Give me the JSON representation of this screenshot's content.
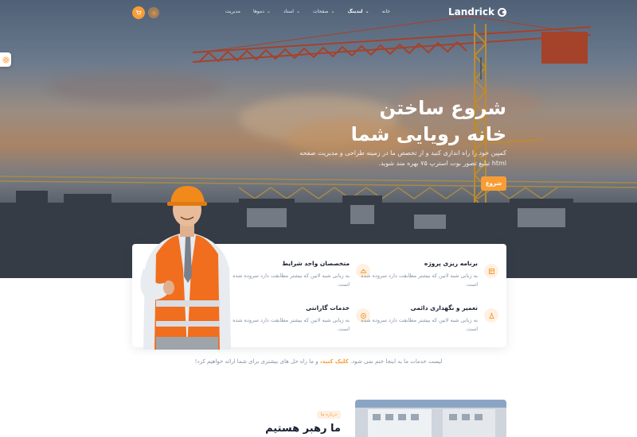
{
  "brand": {
    "name": "Landrick"
  },
  "nav": {
    "items": [
      {
        "label": "خانه",
        "dropdown": false,
        "active": false
      },
      {
        "label": "لندینگ",
        "dropdown": true,
        "active": true
      },
      {
        "label": "صفحات",
        "dropdown": true,
        "active": false
      },
      {
        "label": "اسناد",
        "dropdown": true,
        "active": false
      },
      {
        "label": "دموها",
        "dropdown": true,
        "active": false
      },
      {
        "label": "مدیریت",
        "dropdown": false,
        "active": false
      }
    ]
  },
  "icons": {
    "cart": "shopping-cart-icon",
    "settings": "gear-icon",
    "side_settings": "gear-icon"
  },
  "hero": {
    "title_line1": "شروع ساختن",
    "title_line2": "خانه رویایی شما",
    "description": "کمپین خود را راه اندازی کنید و از تخصص ما در زمینه طراحی و مدیریت صفحه html تبلیغ تصور بوت استرپ ۷۵ بهره مند شوید.",
    "button": "شروع"
  },
  "features": [
    {
      "title": "برنامه ریزی پروژه",
      "text": "به زبانی شبه لاتین که بیشتر مطابقت دارد سروده شده است.",
      "icon": "layout-icon"
    },
    {
      "title": "متخصصان واجد شرایط",
      "text": "به زبانی شبه لاتین که بیشتر مطابقت دارد سروده شده است.",
      "icon": "helmet-icon"
    },
    {
      "title": "تعمیر و نگهداری دائمی",
      "text": "به زبانی شبه لاتین که بیشتر مطابقت دارد سروده شده است.",
      "icon": "cone-icon"
    },
    {
      "title": "خدمات گارانتی",
      "text": "به زبانی شبه لاتین که بیشتر مطابقت دارد سروده شده است.",
      "icon": "award-icon"
    }
  ],
  "services": {
    "prefix": "لیست خدمات ما به اینجا ختم نمی شود.",
    "link": "کلیک کنید،",
    "suffix": "و ما راه حل های بیشتری برای شما ارائه خواهیم کرد!"
  },
  "about": {
    "badge": "درباره ما",
    "title": "ما رهبر هستیم"
  },
  "colors": {
    "accent": "#f89d36",
    "heading": "#161c2d",
    "muted": "#8492a6"
  }
}
